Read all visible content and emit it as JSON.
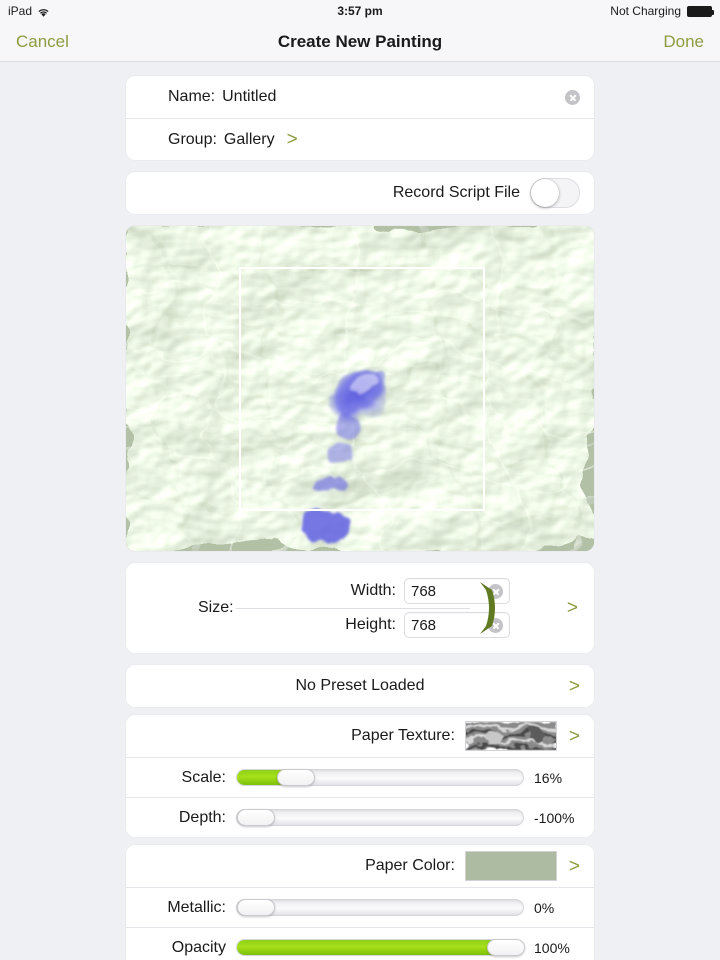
{
  "statusbar": {
    "device": "iPad",
    "wifi_icon": "wifi-icon",
    "time": "3:57 pm",
    "battery_text": "Not Charging",
    "battery_icon": "battery-full-icon"
  },
  "navbar": {
    "cancel_label": "Cancel",
    "title": "Create New Painting",
    "done_label": "Done"
  },
  "form": {
    "name_label": "Name:",
    "name_value": "Untitled",
    "name_placeholder": "Untitled",
    "group_label": "Group:",
    "group_value": "Gallery",
    "record_script_label": "Record Script File",
    "record_script_on": false
  },
  "size": {
    "label": "Size:",
    "width_label": "Width:",
    "width_value": "768",
    "height_label": "Height:",
    "height_value": "768",
    "link_icon": "link-aspect-ratio-icon"
  },
  "preset": {
    "label": "No Preset Loaded"
  },
  "paper": {
    "texture_label": "Paper Texture:",
    "color_label": "Paper Color:",
    "color_value": "#adbba3"
  },
  "sliders": [
    {
      "label": "Scale:",
      "value_text": "16%",
      "percent": 16
    },
    {
      "label": "Depth:",
      "value_text": "-100%",
      "percent": 0
    },
    {
      "label": "Metallic:",
      "value_text": "0%",
      "percent": 0
    },
    {
      "label": "Opacity",
      "value_text": "100%",
      "percent": 100
    }
  ],
  "colors": {
    "accent": "#8d9c3f",
    "slider_green": "#9ed817",
    "paper_green": "#adbba3",
    "paint_blue": "#5a5ae0",
    "background": "#eff0f4"
  },
  "icons": {
    "chevron": ">"
  }
}
